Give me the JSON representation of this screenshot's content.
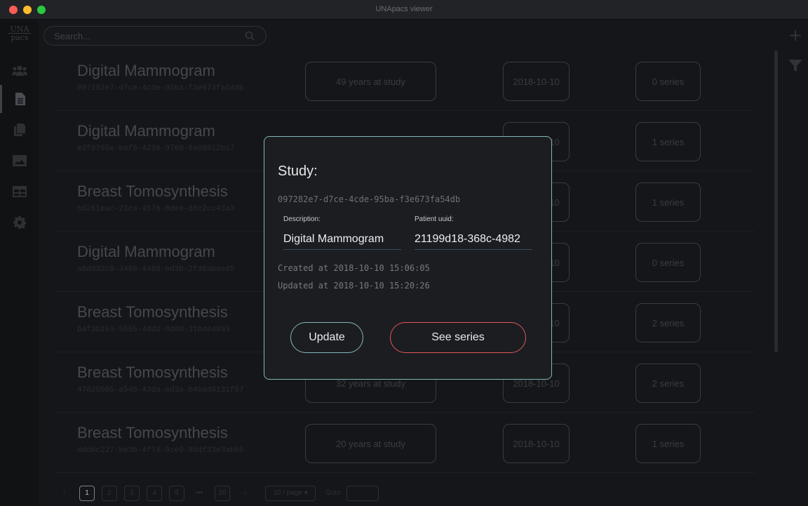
{
  "window": {
    "title": "UNApacs viewer"
  },
  "sidebar": {
    "logo_top": "UNA",
    "logo_bottom": "pacs",
    "items": [
      {
        "icon": "users-icon",
        "active": false
      },
      {
        "icon": "document-icon",
        "active": true
      },
      {
        "icon": "copy-icon",
        "active": false
      },
      {
        "icon": "image-icon",
        "active": false
      },
      {
        "icon": "table-icon",
        "active": false
      },
      {
        "icon": "gear-icon",
        "active": false
      }
    ]
  },
  "search": {
    "placeholder": "Search...",
    "value": ""
  },
  "studies": [
    {
      "title": "Digital Mammogram",
      "uuid": "097282e7-d7ce-4cde-95ba-f3e673fa54db",
      "age": "49 years at study",
      "date": "2018-10-10",
      "series": "0 series"
    },
    {
      "title": "Digital Mammogram",
      "uuid": "e2f0765e-baf8-4236-9760-6a00912b17",
      "age": "",
      "date": "2018-10-10",
      "series": "1 series"
    },
    {
      "title": "Breast Tomosynthesis",
      "uuid": "b8261eac-21ca-4576-8dee-d8c2cc43a3",
      "age": "",
      "date": "2018-10-10",
      "series": "1 series"
    },
    {
      "title": "Digital Mammogram",
      "uuid": "a6dd32c8-3460-4488-bd3b-2fd6abae65",
      "age": "",
      "date": "2018-10-10",
      "series": "0 series"
    },
    {
      "title": "Breast Tomosynthesis",
      "uuid": "b4f3b263-5965-4dd2-8d0d-31bde4893",
      "age": "",
      "date": "2018-10-10",
      "series": "2 series"
    },
    {
      "title": "Breast Tomosynthesis",
      "uuid": "47825585-a548-43da-ad3a-b4bad4131f67",
      "age": "32 years at study",
      "date": "2018-10-10",
      "series": "2 series"
    },
    {
      "title": "Breast Tomosynthesis",
      "uuid": "edd6c227-be3b-4f74-9ce9-95df33e3ab65",
      "age": "20 years at study",
      "date": "2018-10-10",
      "series": "1 series"
    }
  ],
  "pagination": {
    "prev": "‹",
    "pages": [
      "1",
      "2",
      "3",
      "4",
      "5"
    ],
    "ellipsis": "•••",
    "last": "20",
    "next": "›",
    "per_page": "10 / page ▾",
    "goto_label": "Goto",
    "goto_value": ""
  },
  "modal": {
    "heading": "Study:",
    "uuid": "097282e7-d7ce-4cde-95ba-f3e673fa54db",
    "description_label": "Description:",
    "description_value": "Digital Mammogram",
    "patient_label": "Patient uuid:",
    "patient_value": "21199d18-368c-4982",
    "created": "Created at 2018-10-10 15:06:05",
    "updated": "Updated at 2018-10-10 15:20:26",
    "update_label": "Update",
    "see_series_label": "See series"
  },
  "colors": {
    "accent_teal": "#84b6ba",
    "accent_red": "#e2565b",
    "background": "#151619"
  }
}
